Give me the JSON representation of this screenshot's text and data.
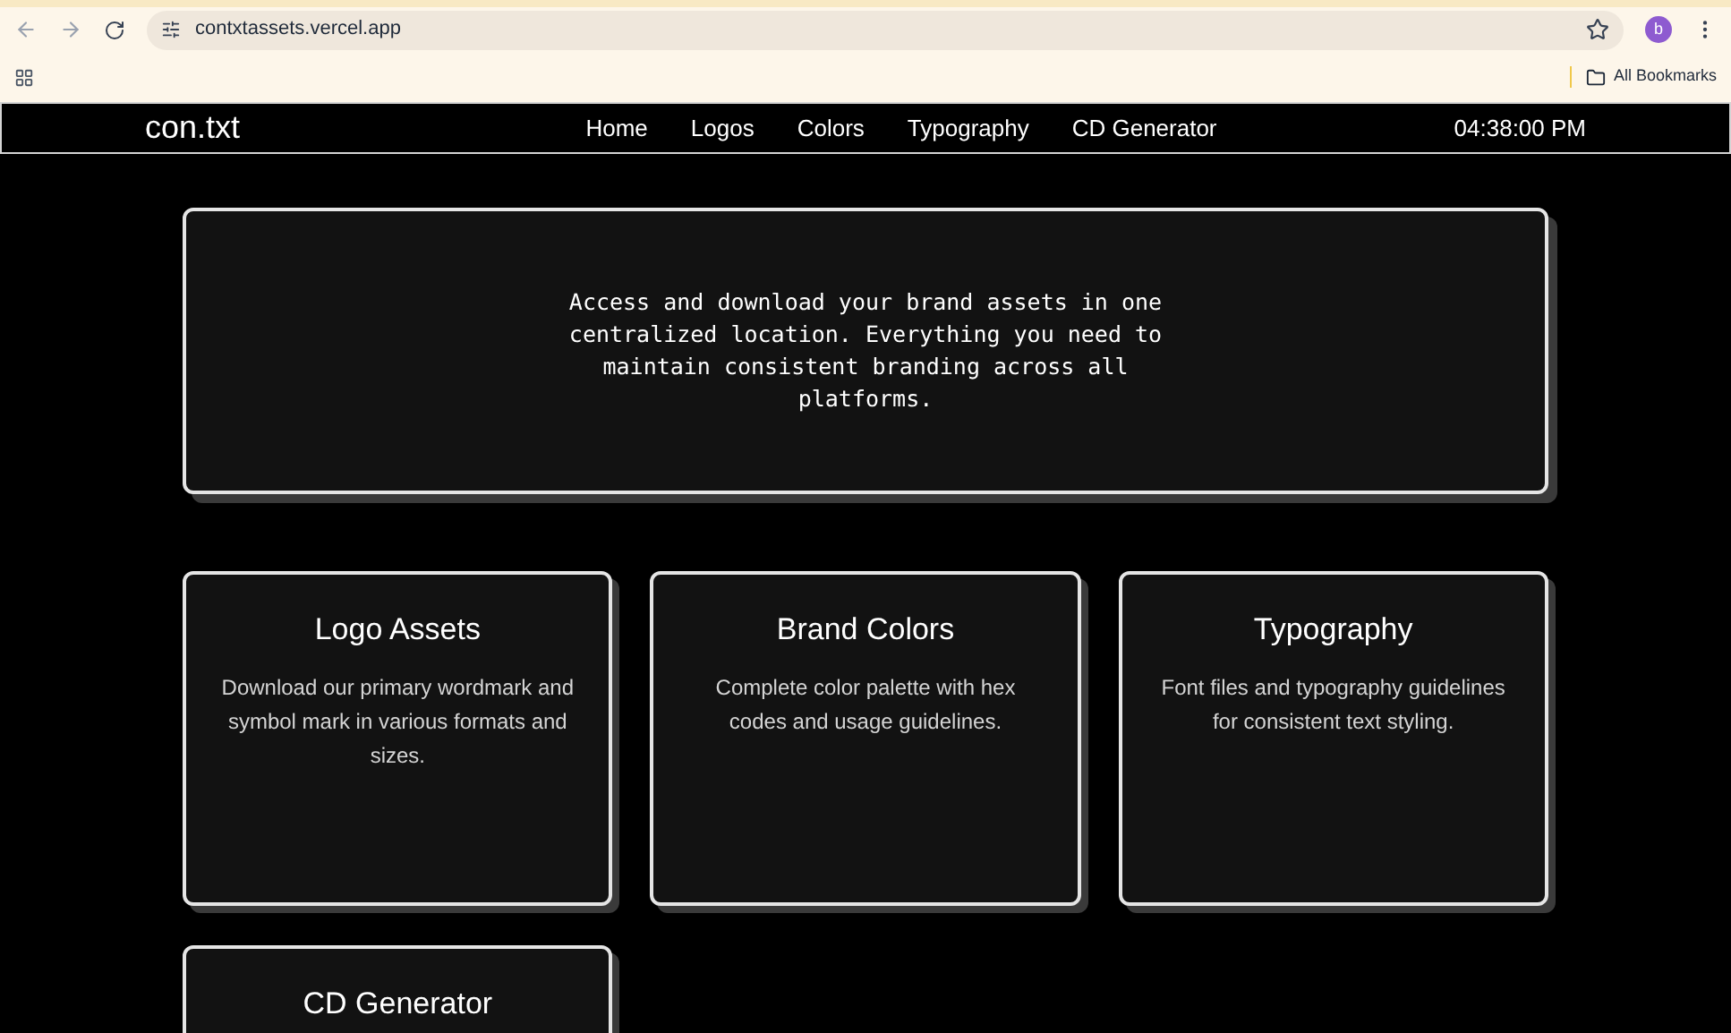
{
  "browser": {
    "url": "contxtassets.vercel.app",
    "profile_initial": "b",
    "bookmarks_label": "All Bookmarks"
  },
  "nav": {
    "logo": "con.txt",
    "links": [
      "Home",
      "Logos",
      "Colors",
      "Typography",
      "CD Generator"
    ],
    "time": "04:38:00 PM"
  },
  "hero": {
    "text": "Access and download your brand assets in one centralized location. Everything you need to maintain consistent branding across all platforms."
  },
  "cards": [
    {
      "title": "Logo Assets",
      "description": "Download our primary wordmark and symbol mark in various formats and sizes."
    },
    {
      "title": "Brand Colors",
      "description": "Complete color palette with hex codes and usage guidelines."
    },
    {
      "title": "Typography",
      "description": "Font files and typography guidelines for consistent text styling."
    },
    {
      "title": "CD Generator"
    }
  ]
}
